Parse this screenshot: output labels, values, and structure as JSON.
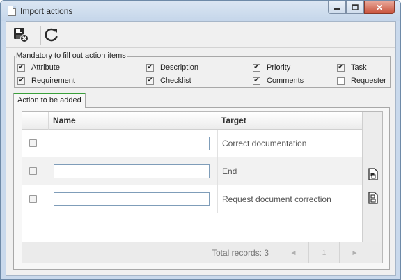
{
  "window": {
    "title": "Import actions",
    "buttons": {
      "minimize": "▭",
      "maximize": "□",
      "close": "✕"
    }
  },
  "toolbar": {
    "save_icon": "save-exit-icon",
    "refresh_icon": "refresh-icon"
  },
  "mandatory": {
    "legend": "Mandatory to fill out action items",
    "items": [
      {
        "label": "Attribute",
        "checked": true
      },
      {
        "label": "Description",
        "checked": true
      },
      {
        "label": "Priority",
        "checked": true
      },
      {
        "label": "Task",
        "checked": true
      },
      {
        "label": "Requirement",
        "checked": true
      },
      {
        "label": "Checklist",
        "checked": true
      },
      {
        "label": "Comments",
        "checked": true
      },
      {
        "label": "Requester",
        "checked": false
      }
    ]
  },
  "tab": {
    "label": "Action to be added"
  },
  "grid": {
    "columns": {
      "name": "Name",
      "target": "Target"
    },
    "rows": [
      {
        "name": "",
        "target": "Correct documentation"
      },
      {
        "name": "",
        "target": "End"
      },
      {
        "name": "",
        "target": "Request document correction"
      }
    ],
    "footer": {
      "total": "Total records: 3",
      "prev": "◄",
      "page": "1",
      "next": "►"
    }
  }
}
